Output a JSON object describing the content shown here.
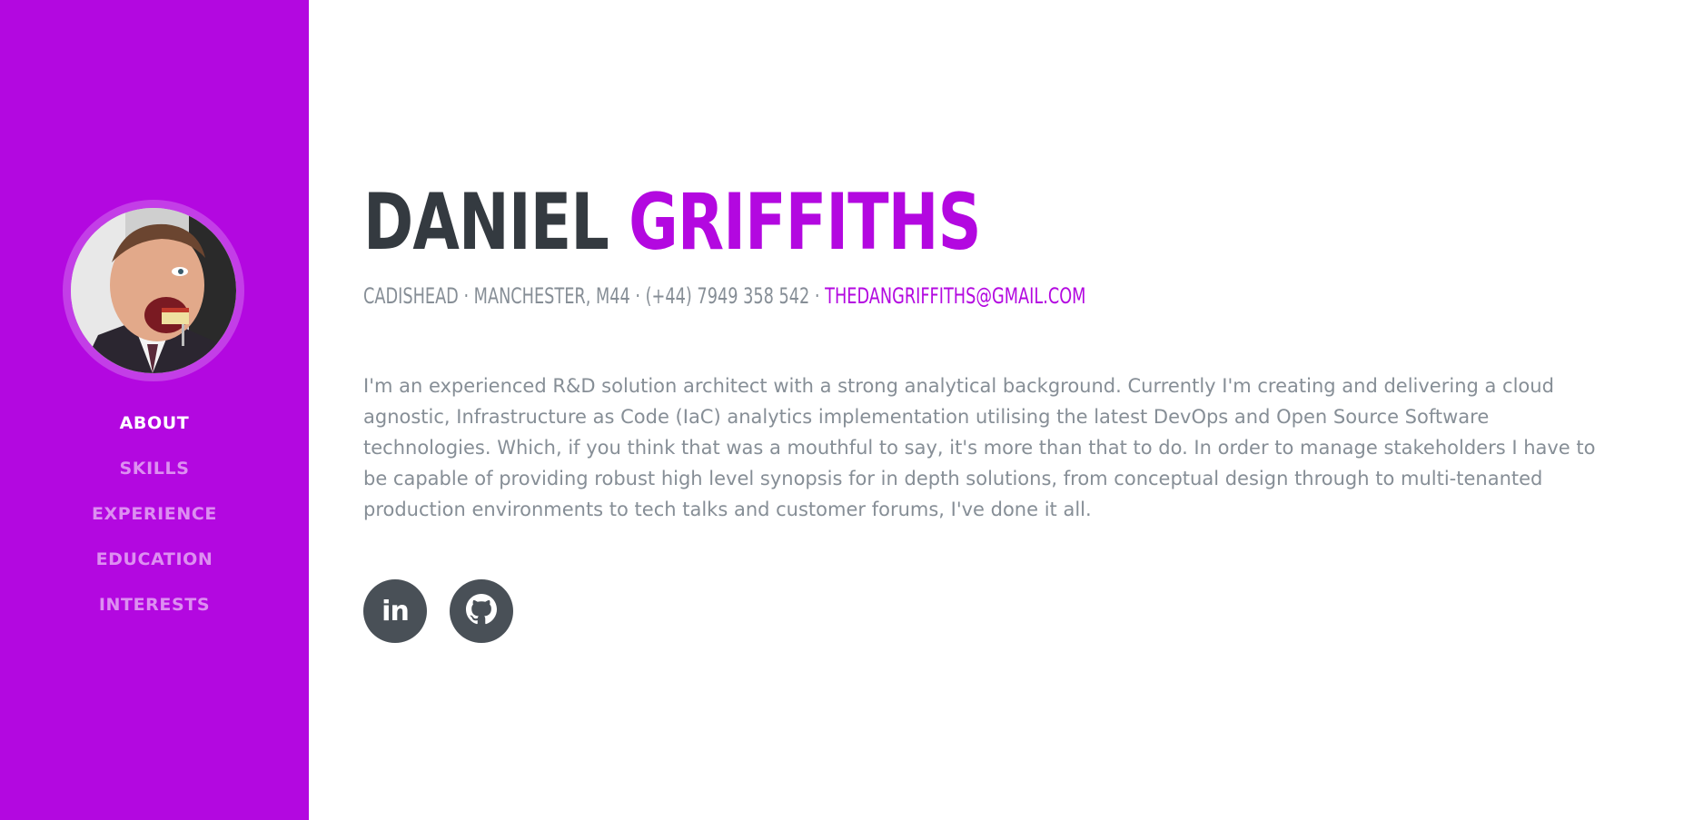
{
  "sidebar": {
    "bg_color": "#b308e0",
    "avatar_alt": "profile photo",
    "nav": [
      {
        "label": "ABOUT",
        "active": true
      },
      {
        "label": "SKILLS",
        "active": false
      },
      {
        "label": "EXPERIENCE",
        "active": false
      },
      {
        "label": "EDUCATION",
        "active": false
      },
      {
        "label": "INTERESTS",
        "active": false
      }
    ]
  },
  "header": {
    "first_name": "DANIEL",
    "last_name": "GRIFFITHS",
    "contact": "CADISHEAD · MANCHESTER, M44 · (+44) 7949 358 542 · ",
    "email": "THEDANGRIFFITHS@GMAIL.COM"
  },
  "about": {
    "bio": "I'm an experienced R&D solution architect with a strong analytical background. Currently I'm creating and delivering a cloud agnostic, Infrastructure as Code (IaC) analytics implementation utilising the latest DevOps and Open Source Software technologies. Which, if you think that was a mouthful to say, it's more than that to do. In order to manage stakeholders I have to be capable of providing robust high level synopsis for in depth solutions, from conceptual design through to multi-tenanted production environments to tech talks and customer forums, I've done it all."
  },
  "social": [
    {
      "icon": "linkedin-icon",
      "glyph": "in"
    },
    {
      "icon": "github-icon"
    }
  ],
  "colors": {
    "accent": "#b308e0",
    "heading": "#343a40",
    "muted": "#868e96",
    "social_bg": "#495057"
  }
}
